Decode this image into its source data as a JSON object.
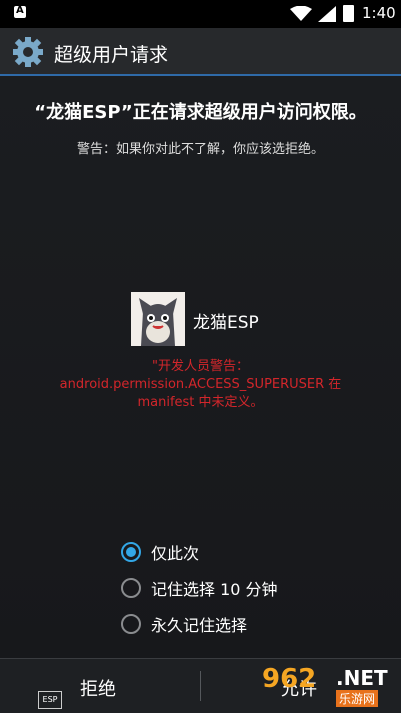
{
  "status_bar": {
    "time": "1:40",
    "left_icon": "a-box-icon",
    "icons": [
      "wifi-icon",
      "signal-icon",
      "battery-charging-icon"
    ]
  },
  "action_bar": {
    "icon": "gear-icon",
    "title": "超级用户请求"
  },
  "request": {
    "heading": "“龙猫ESP”正在请求超级用户访问权限。",
    "warning": "警告：如果你对此不了解，你应该选拒绝。"
  },
  "app": {
    "name": "龙猫ESP",
    "icon": "app-avatar-icon"
  },
  "developer_warning": {
    "line1": "\"开发人员警告：",
    "line2": "android.permission.ACCESS_SUPERUSER 在",
    "line3": "manifest 中未定义。"
  },
  "options": [
    {
      "label": "仅此次",
      "selected": true
    },
    {
      "label": "记住选择 10 分钟",
      "selected": false
    },
    {
      "label": "永久记住选择",
      "selected": false
    }
  ],
  "bottom_bar": {
    "deny_label": "拒绝",
    "allow_label": "允许",
    "esp_chip": "ESP"
  },
  "watermark": {
    "logo": "962",
    "net": ".NET",
    "sub": "乐游网"
  },
  "colors": {
    "accent": "#33a7e6",
    "warning_red": "#d3262b",
    "action_bar_underline": "#2f6aa8"
  }
}
